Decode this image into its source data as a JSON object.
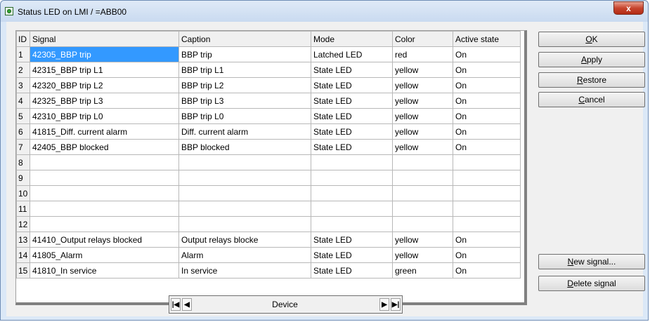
{
  "window": {
    "title": "Status LED on LMI / =ABB00",
    "close_label": "x"
  },
  "table": {
    "columns": [
      "ID",
      "Signal",
      "Caption",
      "Mode",
      "Color",
      "Active state"
    ],
    "rows": [
      {
        "id": "1",
        "signal": "42305_BBP trip",
        "caption": "BBP trip",
        "mode": "Latched LED",
        "color": "red",
        "active": "On"
      },
      {
        "id": "2",
        "signal": "42315_BBP trip L1",
        "caption": "BBP trip L1",
        "mode": "State LED",
        "color": "yellow",
        "active": "On"
      },
      {
        "id": "3",
        "signal": "42320_BBP trip L2",
        "caption": "BBP trip L2",
        "mode": "State LED",
        "color": "yellow",
        "active": "On"
      },
      {
        "id": "4",
        "signal": "42325_BBP trip L3",
        "caption": "BBP trip L3",
        "mode": "State LED",
        "color": "yellow",
        "active": "On"
      },
      {
        "id": "5",
        "signal": "42310_BBP trip L0",
        "caption": "BBP trip L0",
        "mode": "State LED",
        "color": "yellow",
        "active": "On"
      },
      {
        "id": "6",
        "signal": "41815_Diff. current alarm",
        "caption": "Diff. current alarm",
        "mode": "State LED",
        "color": "yellow",
        "active": "On"
      },
      {
        "id": "7",
        "signal": "42405_BBP blocked",
        "caption": "BBP blocked",
        "mode": "State LED",
        "color": "yellow",
        "active": "On"
      },
      {
        "id": "8",
        "signal": "",
        "caption": "",
        "mode": "",
        "color": "",
        "active": ""
      },
      {
        "id": "9",
        "signal": "",
        "caption": "",
        "mode": "",
        "color": "",
        "active": ""
      },
      {
        "id": "10",
        "signal": "",
        "caption": "",
        "mode": "",
        "color": "",
        "active": ""
      },
      {
        "id": "11",
        "signal": "",
        "caption": "",
        "mode": "",
        "color": "",
        "active": ""
      },
      {
        "id": "12",
        "signal": "",
        "caption": "",
        "mode": "",
        "color": "",
        "active": ""
      },
      {
        "id": "13",
        "signal": "41410_Output relays blocked",
        "caption": "Output relays blocke",
        "mode": "State LED",
        "color": "yellow",
        "active": "On"
      },
      {
        "id": "14",
        "signal": "41805_Alarm",
        "caption": "Alarm",
        "mode": "State LED",
        "color": "yellow",
        "active": "On"
      },
      {
        "id": "15",
        "signal": "41810_In service",
        "caption": "In service",
        "mode": "State LED",
        "color": "green",
        "active": "On"
      }
    ]
  },
  "buttons": {
    "ok": {
      "underlined": "O",
      "rest": "K"
    },
    "apply": {
      "underlined": "A",
      "rest": "pply"
    },
    "restore": {
      "underlined": "R",
      "rest": "estore"
    },
    "cancel": {
      "underlined": "C",
      "rest": "ancel"
    },
    "new_signal": {
      "underlined": "N",
      "rest": "ew signal..."
    },
    "delete_signal": {
      "underlined": "D",
      "rest": "elete signal"
    }
  },
  "navigator": {
    "label": "Device",
    "first_icon": "first-record-icon",
    "prev_icon": "previous-record-icon",
    "next_icon": "next-record-icon",
    "last_icon": "last-record-icon"
  },
  "colors": {
    "selection": "#3399ff",
    "title_bar": "#c9daf0",
    "close_button": "#c7452e"
  }
}
